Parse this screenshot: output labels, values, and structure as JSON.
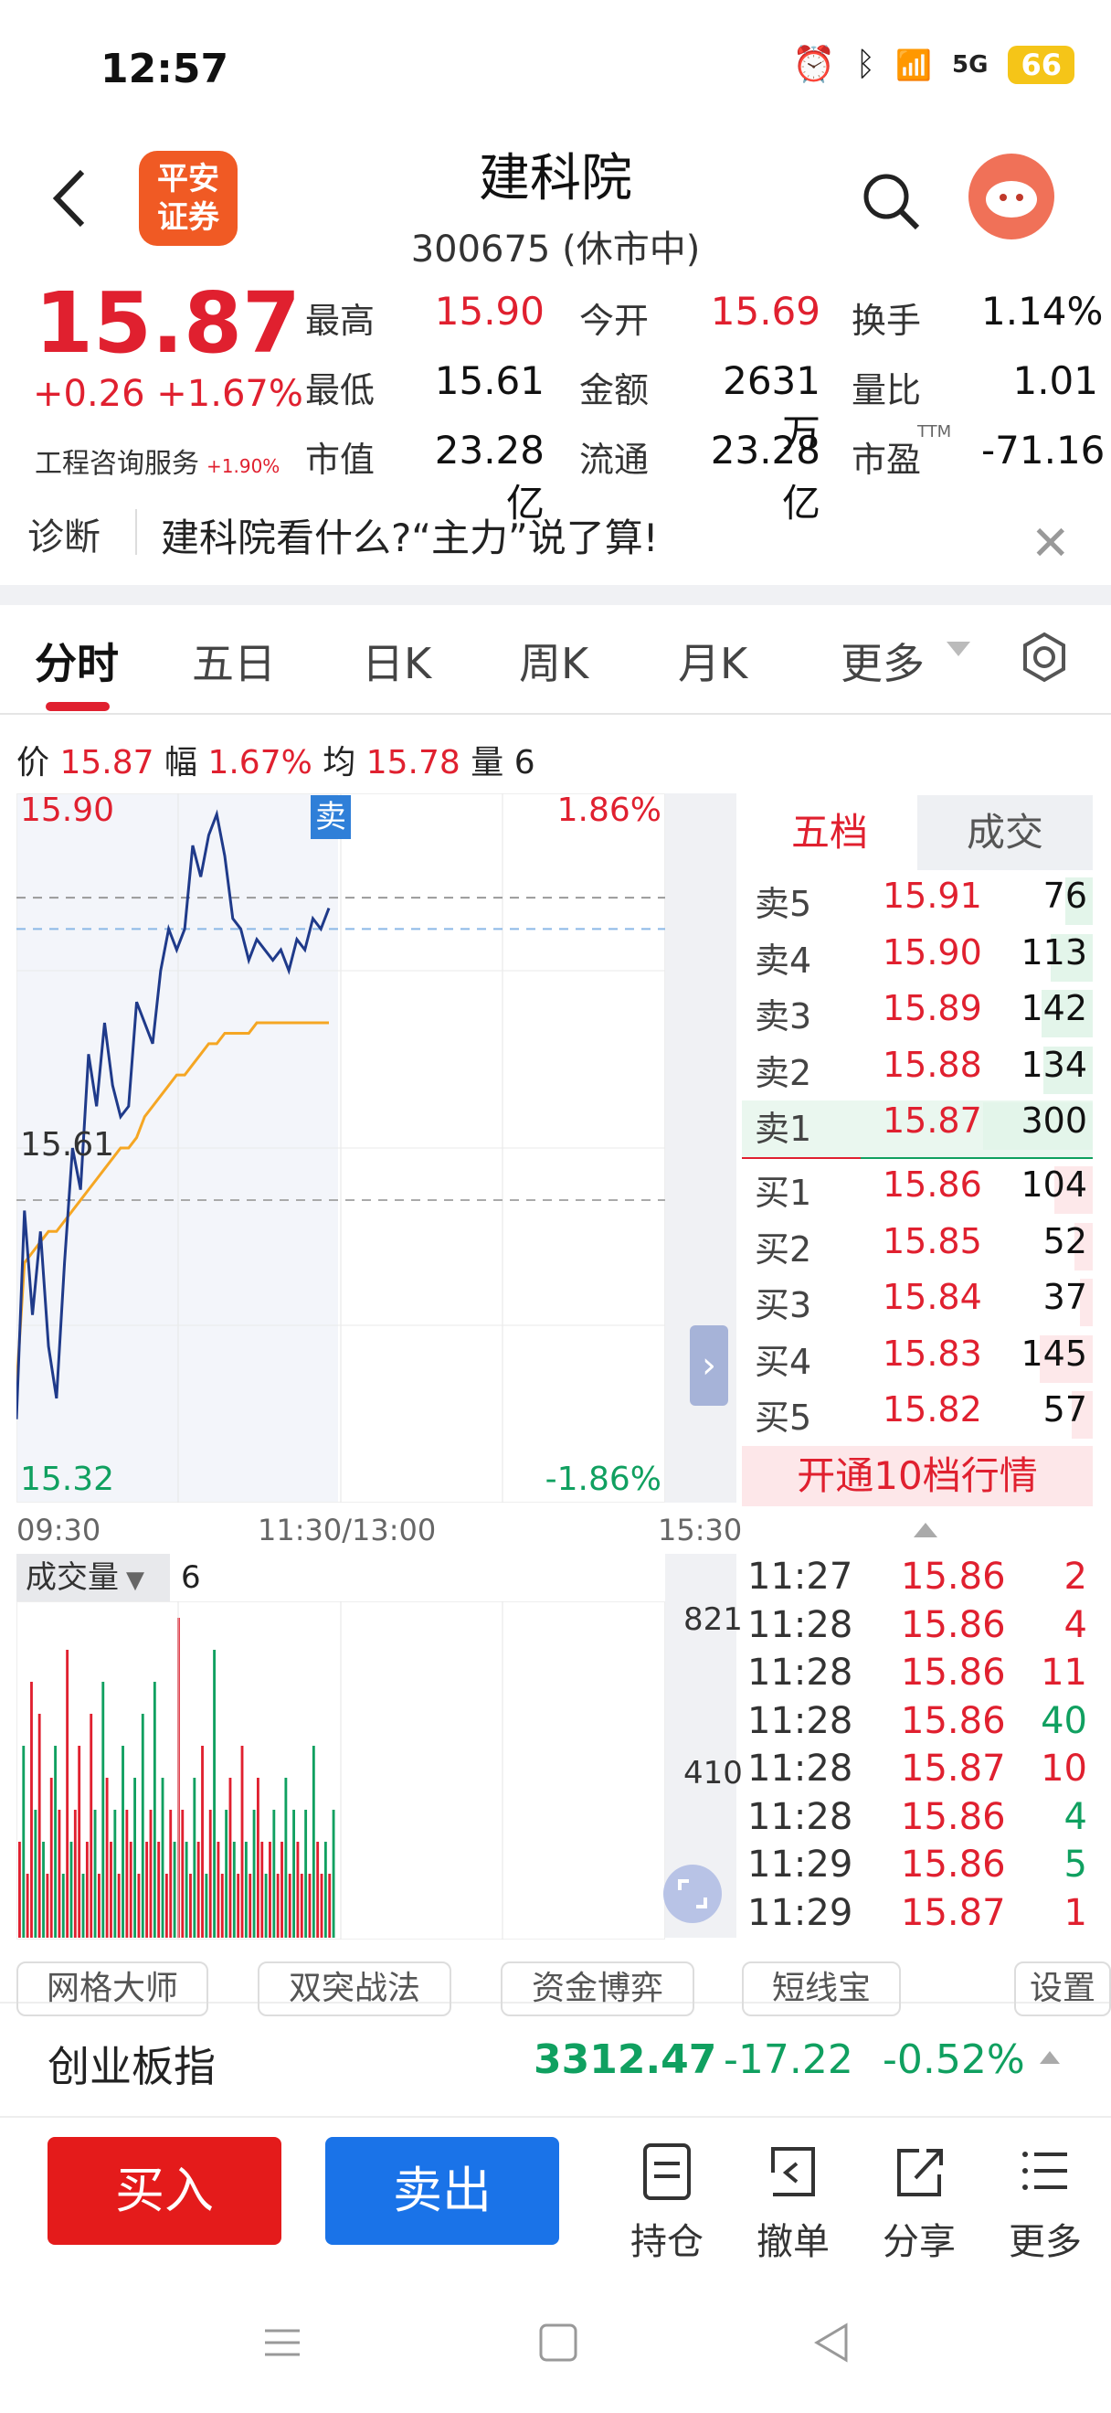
{
  "status_bar": {
    "time": "12:57",
    "network": "5G",
    "battery": "66"
  },
  "header": {
    "title": "建科院",
    "subtitle": "300675 (休市中)",
    "logo_text": "平安证券"
  },
  "quote": {
    "price": "15.87",
    "change": "+0.26 +1.67%",
    "industry": "工程咨询服务",
    "industry_change": "+1.90%",
    "fields": [
      {
        "label": "最高",
        "value": "15.90",
        "color": "red"
      },
      {
        "label": "今开",
        "value": "15.69",
        "color": "red"
      },
      {
        "label": "换手",
        "value": "1.14%",
        "color": "black"
      },
      {
        "label": "最低",
        "value": "15.61",
        "color": "black"
      },
      {
        "label": "金额",
        "value": "2631万",
        "color": "black"
      },
      {
        "label": "量比",
        "value": "1.01",
        "color": "black"
      },
      {
        "label": "市值",
        "value": "23.28亿",
        "color": "black"
      },
      {
        "label": "流通",
        "value": "23.28亿",
        "color": "black"
      },
      {
        "label": "市盈",
        "value": "-71.16",
        "color": "black"
      }
    ],
    "pe_sup": "TTM"
  },
  "diagnosis": {
    "label": "诊断",
    "text": "建科院看什么?“主力”说了算!"
  },
  "tabs": [
    "分时",
    "五日",
    "日K",
    "周K",
    "月K",
    "更多"
  ],
  "info_row": {
    "price_label": "价",
    "price": "15.87",
    "range_label": "幅",
    "range": "1.67%",
    "avg_label": "均",
    "avg": "15.78",
    "vol_label": "量",
    "vol": "6"
  },
  "chart": {
    "y_top": "15.90",
    "y_mid": "15.61",
    "y_bottom": "15.32",
    "pct_top": "1.86%",
    "pct_bottom": "-1.86%",
    "sell_tag": "卖",
    "time_start": "09:30",
    "time_mid": "11:30/13:00",
    "time_end": "15:30",
    "price_line": [
      15.4,
      15.6,
      15.5,
      15.58,
      15.47,
      15.42,
      15.55,
      15.66,
      15.62,
      15.75,
      15.7,
      15.78,
      15.72,
      15.69,
      15.7,
      15.8,
      15.78,
      15.76,
      15.83,
      15.87,
      15.85,
      15.87,
      15.95,
      15.92,
      15.96,
      15.98,
      15.94,
      15.88,
      15.87,
      15.84,
      15.86,
      15.85,
      15.84,
      15.85,
      15.83,
      15.86,
      15.85,
      15.88,
      15.87,
      15.89
    ],
    "avg_line": [
      15.43,
      15.55,
      15.56,
      15.57,
      15.58,
      15.58,
      15.59,
      15.6,
      15.61,
      15.62,
      15.63,
      15.64,
      15.65,
      15.66,
      15.66,
      15.67,
      15.69,
      15.7,
      15.71,
      15.72,
      15.73,
      15.73,
      15.74,
      15.75,
      15.76,
      15.76,
      15.77,
      15.77,
      15.77,
      15.77,
      15.78,
      15.78,
      15.78,
      15.78,
      15.78,
      15.78,
      15.78,
      15.78,
      15.78,
      15.78
    ]
  },
  "orderbook": {
    "tab_active": "五档",
    "tab_other": "成交",
    "sells": [
      {
        "label": "卖5",
        "price": "15.91",
        "vol": "76",
        "fill": 0.25
      },
      {
        "label": "卖4",
        "price": "15.90",
        "vol": "113",
        "fill": 0.38
      },
      {
        "label": "卖3",
        "price": "15.89",
        "vol": "142",
        "fill": 0.47
      },
      {
        "label": "卖2",
        "price": "15.88",
        "vol": "134",
        "fill": 0.45
      },
      {
        "label": "卖1",
        "price": "15.87",
        "vol": "300",
        "fill": 1.0
      }
    ],
    "buys": [
      {
        "label": "买1",
        "price": "15.86",
        "vol": "104",
        "fill": 0.35
      },
      {
        "label": "买2",
        "price": "15.85",
        "vol": "52",
        "fill": 0.17
      },
      {
        "label": "买3",
        "price": "15.84",
        "vol": "37",
        "fill": 0.12
      },
      {
        "label": "买4",
        "price": "15.83",
        "vol": "145",
        "fill": 0.48
      },
      {
        "label": "买5",
        "price": "15.82",
        "vol": "57",
        "fill": 0.19
      }
    ],
    "open_more": "开通10档行情"
  },
  "volume": {
    "label": "成交量",
    "value": "6",
    "ax_top": "821",
    "ax_mid": "410",
    "bars": [
      3,
      6,
      2,
      8,
      4,
      7,
      3,
      2,
      5,
      6,
      4,
      2,
      9,
      3,
      4,
      6,
      2,
      3,
      7,
      4,
      2,
      8,
      5,
      3,
      4,
      2,
      6,
      4,
      3,
      5,
      2,
      7,
      3,
      4,
      8,
      3,
      5,
      2,
      4,
      3,
      10,
      4,
      3,
      2,
      5,
      3,
      6,
      2,
      4,
      9,
      3,
      2,
      4,
      5,
      3,
      2,
      6,
      3,
      2,
      4,
      5,
      3,
      2,
      3,
      4,
      2,
      3,
      5,
      2,
      4,
      3,
      2,
      4,
      2,
      6,
      3,
      2,
      3,
      2,
      4
    ],
    "bar_colors": [
      "r",
      "g",
      "r",
      "r",
      "g",
      "r",
      "g",
      "r",
      "r",
      "g",
      "r",
      "g",
      "r",
      "g",
      "r",
      "r",
      "g",
      "r",
      "r",
      "g",
      "r",
      "g",
      "r",
      "r",
      "g",
      "r",
      "g",
      "r",
      "r",
      "g",
      "r",
      "g",
      "r",
      "r",
      "g",
      "r",
      "g",
      "r",
      "r",
      "g",
      "r",
      "r",
      "g",
      "r",
      "g",
      "r",
      "r",
      "g",
      "r",
      "g",
      "r",
      "r",
      "g",
      "r",
      "g",
      "r",
      "r",
      "g",
      "r",
      "g",
      "r",
      "r",
      "g",
      "r",
      "g",
      "r",
      "r",
      "g",
      "r",
      "g",
      "r",
      "r",
      "g",
      "r",
      "g",
      "r",
      "r",
      "g",
      "r",
      "g"
    ]
  },
  "trades": [
    {
      "time": "11:27",
      "price": "15.86",
      "vol": "2",
      "pc": "red",
      "vc": "red"
    },
    {
      "time": "11:28",
      "price": "15.86",
      "vol": "4",
      "pc": "red",
      "vc": "red"
    },
    {
      "time": "11:28",
      "price": "15.86",
      "vol": "11",
      "pc": "red",
      "vc": "red"
    },
    {
      "time": "11:28",
      "price": "15.86",
      "vol": "40",
      "pc": "red",
      "vc": "green"
    },
    {
      "time": "11:28",
      "price": "15.87",
      "vol": "10",
      "pc": "red",
      "vc": "red"
    },
    {
      "time": "11:28",
      "price": "15.86",
      "vol": "4",
      "pc": "red",
      "vc": "green"
    },
    {
      "time": "11:29",
      "price": "15.86",
      "vol": "5",
      "pc": "red",
      "vc": "green"
    },
    {
      "time": "11:29",
      "price": "15.87",
      "vol": "1",
      "pc": "red",
      "vc": "red"
    }
  ],
  "tools": [
    "网格大师",
    "双突战法",
    "资金博弈",
    "短线宝",
    "设置"
  ],
  "index": {
    "name": "创业板指",
    "value": "3312.47",
    "change": "-17.22",
    "pct": "-0.52%"
  },
  "bottom": {
    "buy": "买入",
    "sell": "卖出",
    "actions": [
      "持仓",
      "撤单",
      "分享",
      "更多"
    ]
  },
  "colors": {
    "red": "#e0202f",
    "green": "#10a060",
    "blue": "#1a73e8",
    "line": "#1f3a8a",
    "avg": "#f5a623"
  }
}
